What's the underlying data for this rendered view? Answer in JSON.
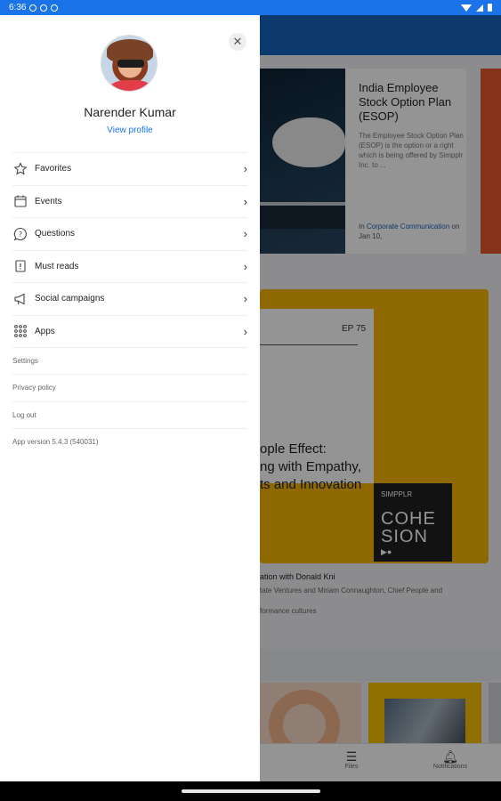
{
  "status_bar": {
    "time": "6:36"
  },
  "drawer": {
    "user_name": "Narender Kumar",
    "view_profile": "View profile",
    "menu": [
      {
        "label": "Favorites",
        "icon": "star-icon"
      },
      {
        "label": "Events",
        "icon": "calendar-icon"
      },
      {
        "label": "Questions",
        "icon": "question-bubble-icon"
      },
      {
        "label": "Must reads",
        "icon": "must-read-icon"
      },
      {
        "label": "Social campaigns",
        "icon": "megaphone-icon"
      },
      {
        "label": "Apps",
        "icon": "apps-grid-icon"
      }
    ],
    "links": {
      "settings": "Settings",
      "privacy": "Privacy policy",
      "logout": "Log out",
      "version": "App version 5.4.3 (540031)"
    }
  },
  "background": {
    "card1": {
      "title": "India Employee Stock Option Plan (ESOP)",
      "description": "The Employee Stock Option Plan (ESOP) is the option or a right which is being offered by Simpplr Inc. to ...",
      "meta_prefix": "In",
      "meta_link": "Corporate Communication",
      "meta_suffix": "on Jan 10,"
    },
    "card2": {
      "episode": "EP 75",
      "headline_line1": "ople Effect:",
      "headline_line2": "ng with Empathy,",
      "headline_line3": "ts and Innovation",
      "brand": "SIMPPLR",
      "cohesion_line1": "COHE",
      "cohesion_line2": "SION",
      "caption1": "ation with Donald Kni",
      "caption2": "tate Ventures and Miriam Connaughton, Chief People and",
      "caption3": "formance cultures"
    },
    "bottom_nav": {
      "item1": "Files",
      "item2": "Notifications"
    }
  }
}
